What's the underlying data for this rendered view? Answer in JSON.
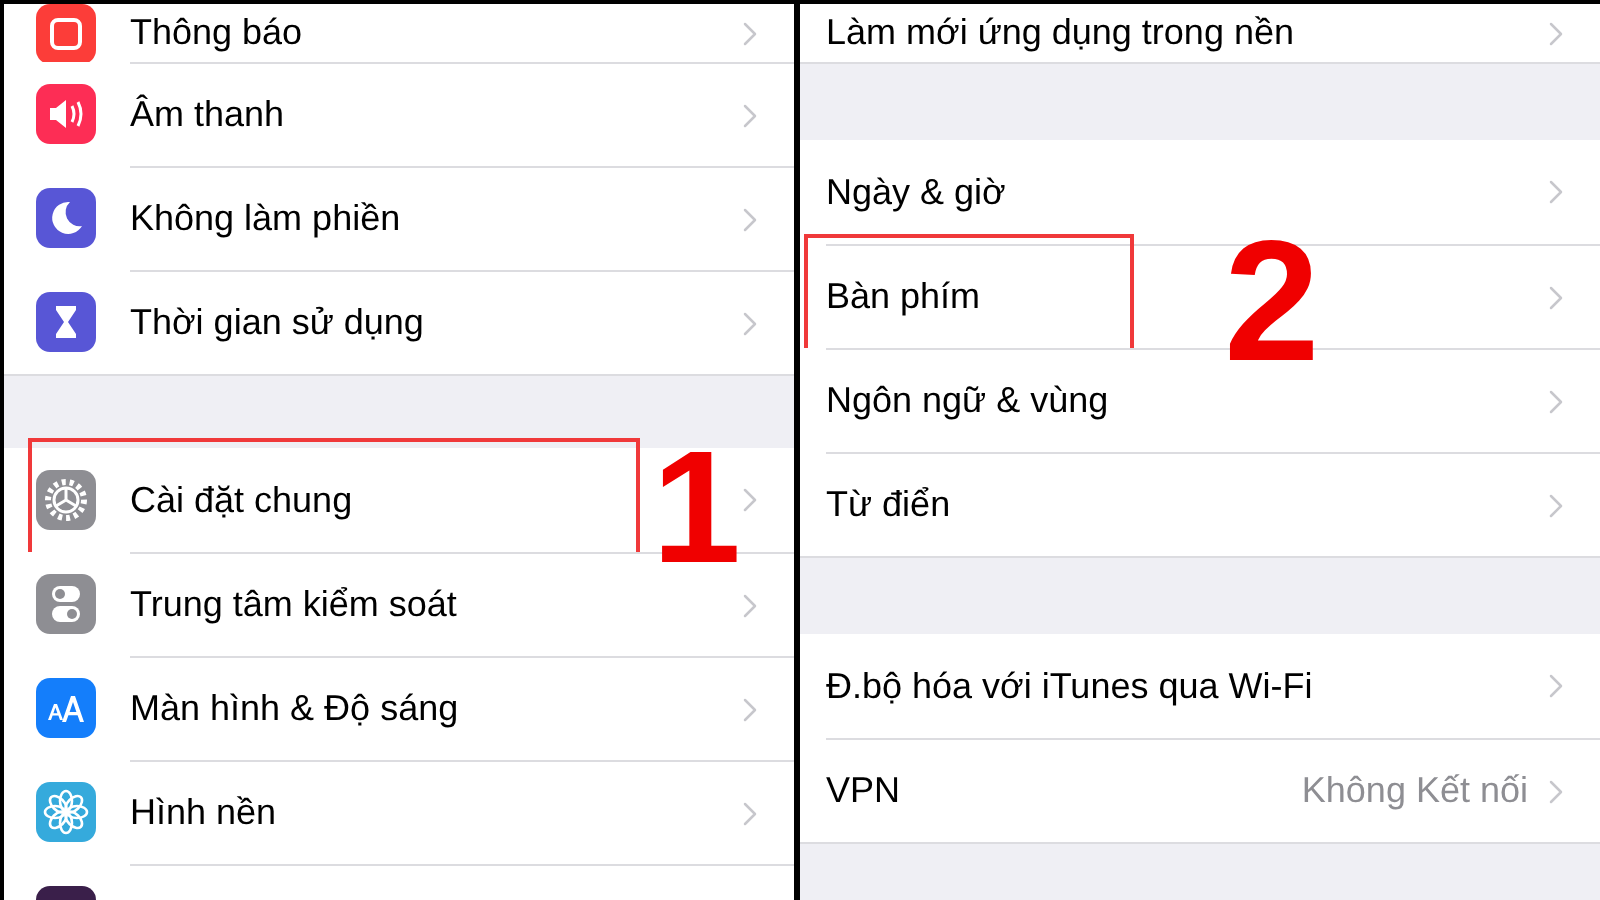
{
  "panels": [
    {
      "step_label": "1",
      "groups": [
        {
          "rows": [
            {
              "label": "Thông báo",
              "color": "#fc3d39",
              "highlighted": false
            },
            {
              "label": "Âm thanh",
              "color": "#fd2d55",
              "highlighted": false
            },
            {
              "label": "Không làm phiền",
              "color": "#5856d6",
              "highlighted": false
            },
            {
              "label": "Thời gian sử dụng",
              "color": "#5856d6",
              "highlighted": false
            }
          ]
        },
        {
          "rows": [
            {
              "label": "Cài đặt chung",
              "color": "#8e8e93",
              "highlighted": true
            },
            {
              "label": "Trung tâm kiểm soát",
              "color": "#8e8e93",
              "highlighted": false
            },
            {
              "label": "Màn hình & Độ sáng",
              "color": "#147efb",
              "highlighted": false
            },
            {
              "label": "Hình nền",
              "color": "#35aadc",
              "highlighted": false
            },
            {
              "color": "#3a1f4a",
              "highlighted": false
            }
          ]
        }
      ]
    },
    {
      "step_label": "2",
      "groups": [
        {
          "rows": [
            {
              "label": "Làm mới ứng dụng trong nền",
              "highlighted": false
            }
          ]
        },
        {
          "rows": [
            {
              "label": "Ngày & giờ",
              "highlighted": false
            },
            {
              "label": "Bàn phím",
              "highlighted": true
            },
            {
              "label": "Ngôn ngữ & vùng",
              "highlighted": false
            },
            {
              "label": "Từ điển",
              "highlighted": false
            }
          ]
        },
        {
          "rows": [
            {
              "label": "Đ.bộ hóa với iTunes qua Wi-Fi",
              "highlighted": false
            },
            {
              "label": "VPN",
              "value": "Không Kết nối",
              "highlighted": false
            }
          ]
        }
      ]
    }
  ]
}
